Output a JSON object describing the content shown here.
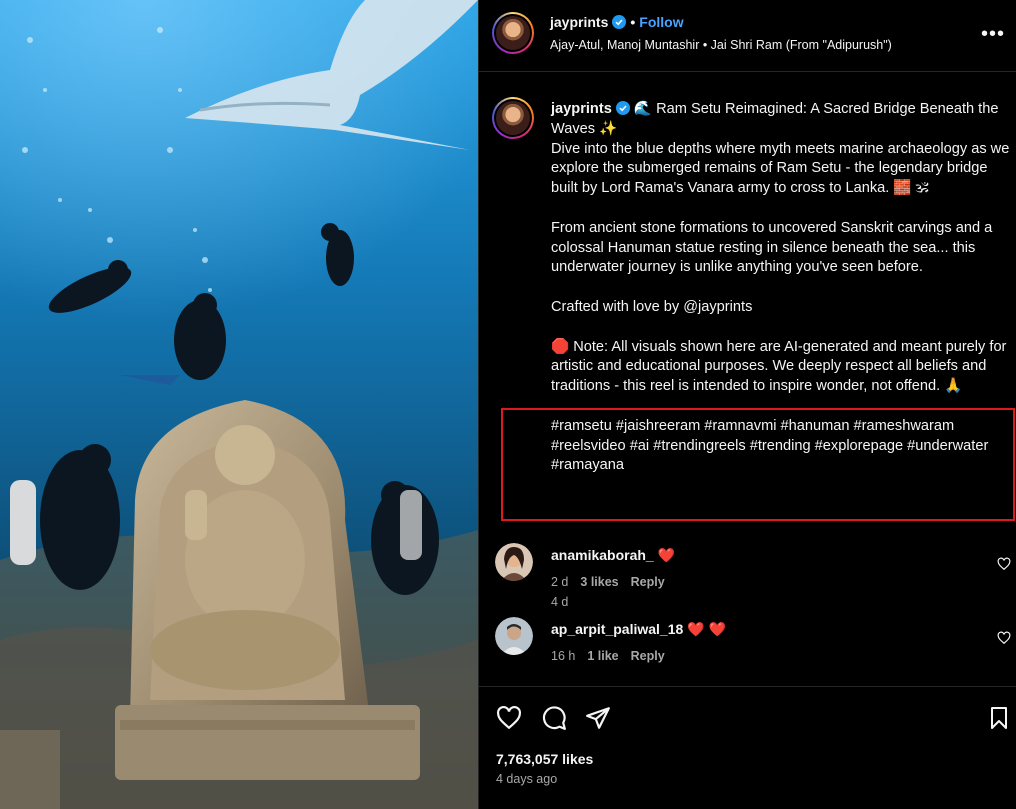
{
  "post": {
    "username": "jayprints",
    "follow_label": "Follow",
    "audio": "Ajay-Atul, Manoj Muntashir • Jai Shri Ram (From \"Adipurush\")",
    "more_label": "•••"
  },
  "caption": {
    "username": "jayprints",
    "line_title": "🌊 Ram Setu Reimagined: A Sacred Bridge Beneath the Waves ✨",
    "para1": "Dive into the blue depths where myth meets marine archaeology as we explore the submerged remains of Ram Setu - the legendary bridge built by Lord Rama's Vanara army to cross to Lanka. 🧱 🕉",
    "para2": "From ancient stone formations to uncovered Sanskrit carvings and a colossal Hanuman statue resting in silence beneath the sea... this underwater journey is unlike anything you've seen before.",
    "para3": "Crafted with love by @jayprints",
    "note": "🛑 Note: All visuals shown here are AI-generated and meant purely for artistic and educational purposes. We deeply respect all beliefs and traditions - this reel is intended to inspire wonder, not offend. 🙏",
    "hashtags": "#ramsetu #jaishreeram #ramnavmi #hanuman #rameshwaram #reelsvideo #ai #trendingreels #trending #explorepage #underwater #ramayana",
    "time_ago": "4 d"
  },
  "comments": [
    {
      "username": "anamikaborah_",
      "emoji": "❤️",
      "time": "2 d",
      "likes": "3 likes",
      "reply": "Reply"
    },
    {
      "username": "ap_arpit_paliwal_18",
      "emoji": "❤️ ❤️",
      "time": "16 h",
      "likes": "1 like",
      "reply": "Reply"
    }
  ],
  "footer": {
    "likes": "7,763,057 likes",
    "posted": "4 days ago"
  },
  "colors": {
    "accent_link": "#4aa3ff",
    "highlight_box": "#e0191e",
    "water_top": "#1b8fd6",
    "water_bottom": "#0c3550"
  },
  "icons": [
    "verified-badge-icon",
    "more-options-icon",
    "heart-icon",
    "comment-icon",
    "share-icon",
    "bookmark-icon"
  ]
}
